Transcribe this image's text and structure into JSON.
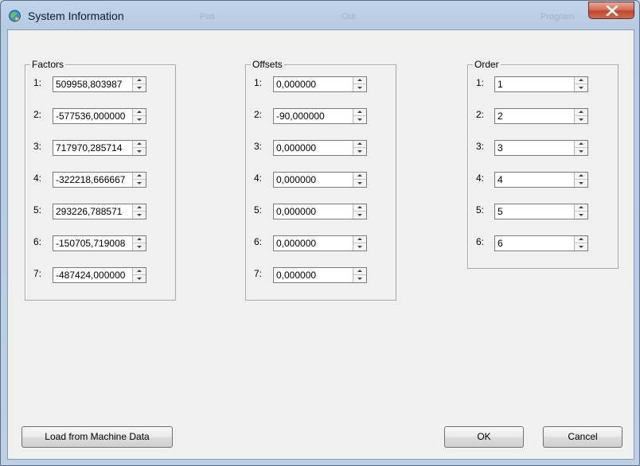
{
  "window": {
    "title": "System Information",
    "icon": "system-info-icon",
    "ghost_labels": [
      "Pos",
      "Out",
      "Program"
    ]
  },
  "groups": {
    "factors": {
      "title": "Factors",
      "rows": [
        {
          "label": "1:",
          "value": "509958,803987"
        },
        {
          "label": "2:",
          "value": "-577536,000000"
        },
        {
          "label": "3:",
          "value": "717970,285714"
        },
        {
          "label": "4:",
          "value": "-322218,666667"
        },
        {
          "label": "5:",
          "value": "293226,788571"
        },
        {
          "label": "6:",
          "value": "-150705,719008"
        },
        {
          "label": "7:",
          "value": "-487424,000000"
        }
      ]
    },
    "offsets": {
      "title": "Offsets",
      "rows": [
        {
          "label": "1:",
          "value": "0,000000"
        },
        {
          "label": "2:",
          "value": "-90,000000"
        },
        {
          "label": "3:",
          "value": "0,000000"
        },
        {
          "label": "4:",
          "value": "0,000000"
        },
        {
          "label": "5:",
          "value": "0,000000"
        },
        {
          "label": "6:",
          "value": "0,000000"
        },
        {
          "label": "7:",
          "value": "0,000000"
        }
      ]
    },
    "order": {
      "title": "Order",
      "rows": [
        {
          "label": "1:",
          "value": "1"
        },
        {
          "label": "2:",
          "value": "2"
        },
        {
          "label": "3:",
          "value": "3"
        },
        {
          "label": "4:",
          "value": "4"
        },
        {
          "label": "5:",
          "value": "5"
        },
        {
          "label": "6:",
          "value": "6"
        }
      ]
    }
  },
  "buttons": {
    "load_label": "Load from Machine Data",
    "ok_label": "OK",
    "cancel_label": "Cancel"
  },
  "colors": {
    "close_button": "#c2472d",
    "client_background": "#f0f0f0",
    "frame": "#b7cbe3"
  }
}
